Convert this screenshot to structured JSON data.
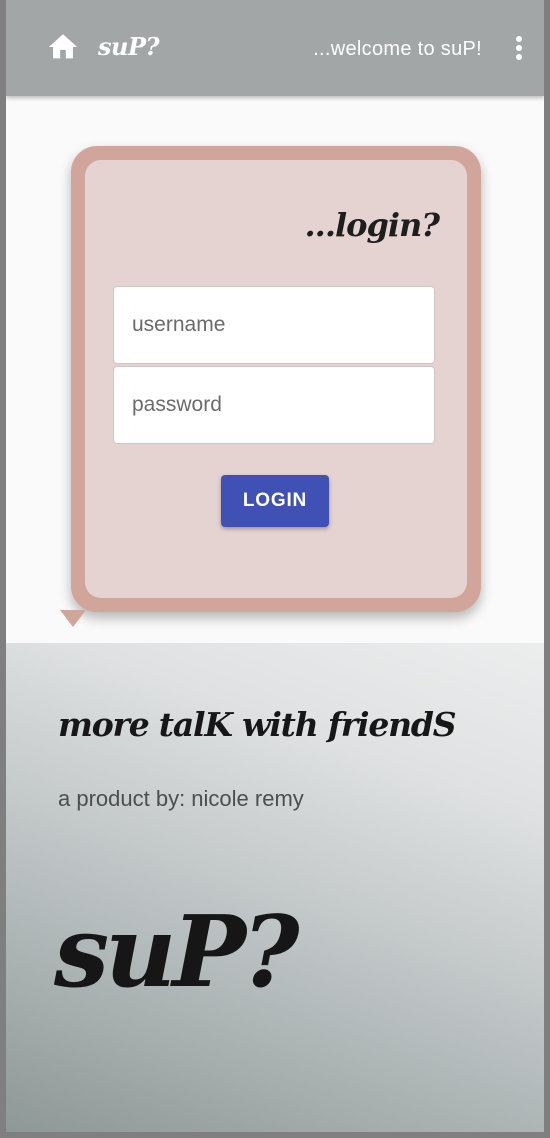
{
  "appbar": {
    "home_icon": "home-icon",
    "brand": "suP?",
    "welcome": "...welcome to suP!",
    "menu_icon": "more-vert-icon",
    "color": "#a3a6a7"
  },
  "login": {
    "title": "...login?",
    "username_placeholder": "username",
    "password_placeholder": "password",
    "button_label": "LOGIN",
    "button_color": "#3f51b5",
    "card_border_color": "#d2a59a",
    "card_fill_color": "#e5d3d1"
  },
  "hero": {
    "tagline": "more talK with friendS",
    "byline": "a product by: nicole remy",
    "logo": "suP?"
  }
}
